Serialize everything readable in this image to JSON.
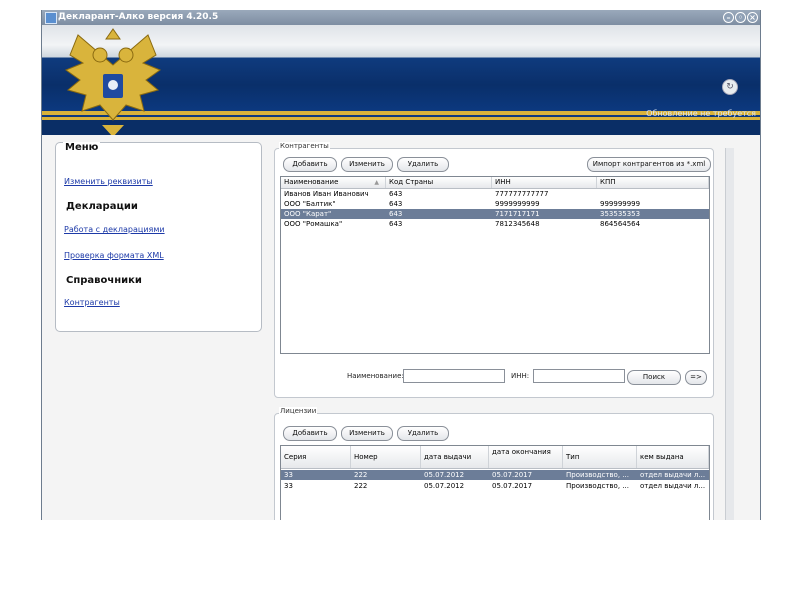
{
  "window": {
    "title": "Декларант-Алко версия 4.20.5"
  },
  "window_buttons": {
    "minimize": "–",
    "restore": "◦",
    "close": "×"
  },
  "banner": {
    "update_icon": "↻",
    "update_text": "Обновление не требуется"
  },
  "menu": {
    "title": "Меню",
    "edit_details": "Изменить реквизиты",
    "declarations_header": "Декларации",
    "work_with_declarations": "Работа с декларациями",
    "xml_check": "Проверка формата XML",
    "references_header": "Справочники",
    "counterparties": "Контрагенты"
  },
  "counterparties": {
    "legend": "Контрагенты",
    "add": "Добавить",
    "edit": "Изменить",
    "delete": "Удалить",
    "import": "Импорт контрагентов из *.xml",
    "columns": [
      "Наименование",
      "Код Страны",
      "ИНН",
      "КПП"
    ],
    "sort_icon": "▲",
    "rows": [
      {
        "name": "Иванов Иван Иванович",
        "country": "643",
        "inn": "777777777777",
        "kpp": "",
        "selected": false
      },
      {
        "name": "ООО \"Балтик\"",
        "country": "643",
        "inn": "9999999999",
        "kpp": "999999999",
        "selected": false
      },
      {
        "name": "ООО \"Карат\"",
        "country": "643",
        "inn": "7171717171",
        "kpp": "353535353",
        "selected": true
      },
      {
        "name": "ООО \"Ромашка\"",
        "country": "643",
        "inn": "7812345648",
        "kpp": "864564564",
        "selected": false
      }
    ],
    "filter_name_label": "Наименование:",
    "filter_inn_label": "ИНН:",
    "search": "Поиск",
    "go": "=>"
  },
  "licenses": {
    "legend": "Лицензии",
    "add": "Добавить",
    "edit": "Изменить",
    "delete": "Удалить",
    "columns": [
      "Серия",
      "Номер",
      "дата выдачи",
      "дата окончания",
      "Тип",
      "кем выдана"
    ],
    "rows": [
      {
        "series": "33",
        "number": "222",
        "issued": "05.07.2012",
        "expires": "05.07.2017",
        "type": "Производство, ...",
        "issuer": "отдел выдачи л...",
        "selected": true
      },
      {
        "series": "33",
        "number": "222",
        "issued": "05.07.2012",
        "expires": "05.07.2017",
        "type": "Производство, ...",
        "issuer": "отдел выдачи л...",
        "selected": false
      }
    ]
  }
}
